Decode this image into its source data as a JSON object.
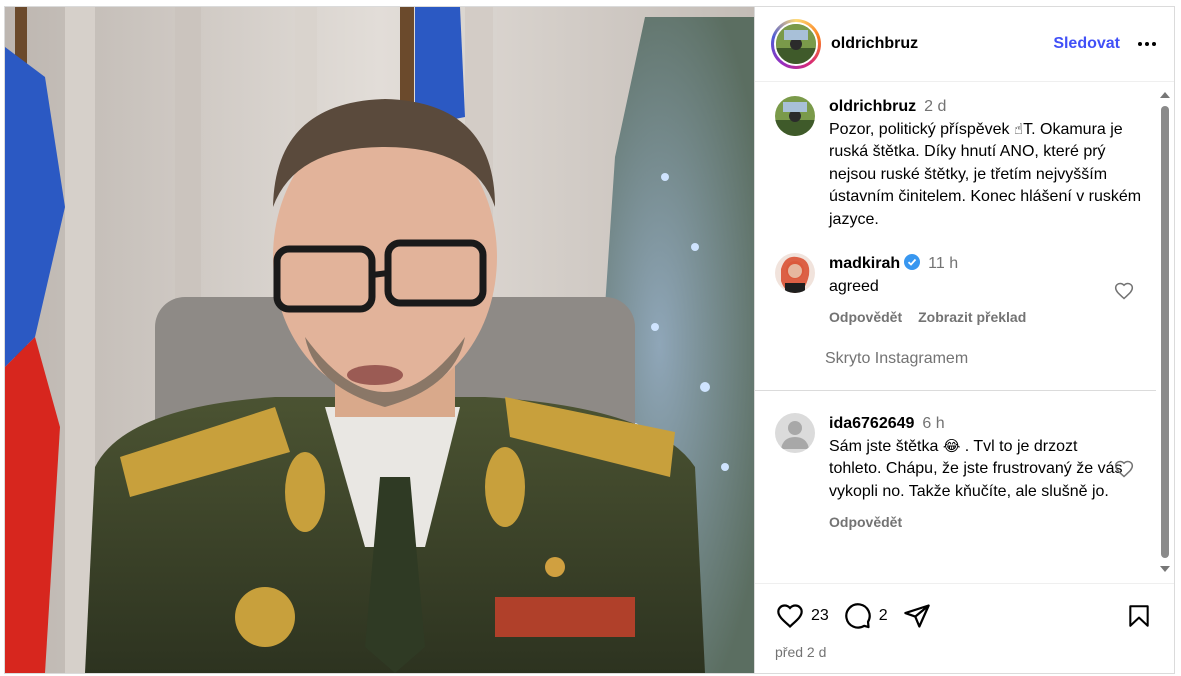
{
  "post": {
    "author": "oldrichbruz",
    "follow_label": "Sledovat",
    "caption": {
      "author": "oldrichbruz",
      "time": "2 d",
      "text_1": "Pozor, politický příspěvek ",
      "emoji": "☝",
      "text_2": "T. Okamura je ruská štětka. Díky hnutí ANO, které prý nejsou ruské štětky, je třetím nejvyšším ústavním činitelem. Konec hlášení v ruském jazyce."
    },
    "comments": [
      {
        "author": "madkirah",
        "verified": true,
        "time": "11 h",
        "text": "agreed",
        "reply_label": "Odpovědět",
        "translate_label": "Zobrazit překlad"
      },
      {
        "author": "ida6762649",
        "verified": false,
        "time": "6 h",
        "text_1": "Sám jste štětka ",
        "emoji": "😂",
        "text_2": " . Tvl to je drzozt tohleto. Chápu, že jste frustrovaný že vás vykopli no. Takže kňučíte, ale slušně jo.",
        "reply_label": "Odpovědět"
      }
    ],
    "hidden_note": "Skryto Instagramem",
    "likes": "23",
    "comment_count": "2",
    "date": "před 2 d"
  },
  "icons": {
    "more": "more-options-icon",
    "like": "heart-icon",
    "comment": "comment-icon",
    "share": "share-icon",
    "save": "bookmark-icon"
  },
  "colors": {
    "follow": "#4150f7",
    "verified": "#3897f0",
    "muted": "#737373"
  }
}
